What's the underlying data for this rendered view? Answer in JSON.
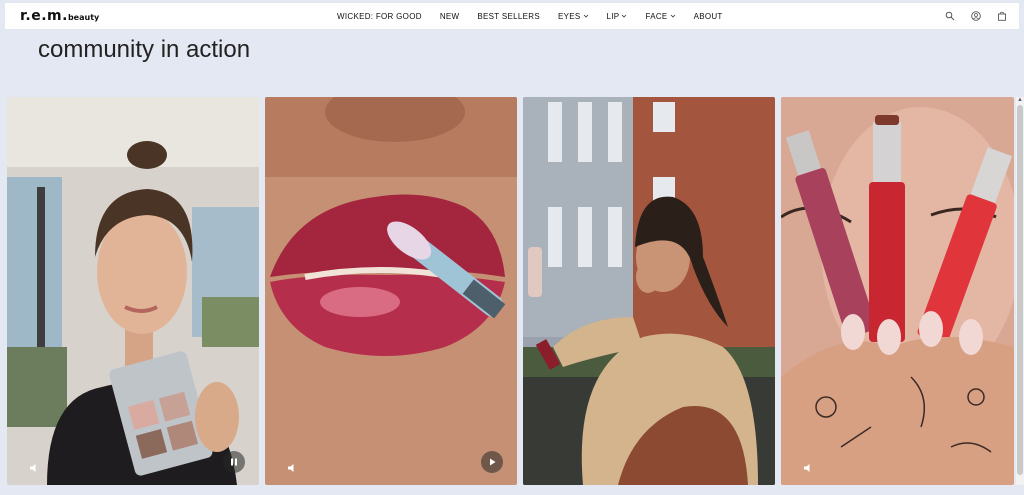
{
  "brand": {
    "logo_main": "r.e.m.",
    "logo_sub": "beauty"
  },
  "nav": {
    "items": [
      {
        "label": "WICKED: FOR GOOD",
        "dropdown": false
      },
      {
        "label": "NEW",
        "dropdown": false
      },
      {
        "label": "BEST SELLERS",
        "dropdown": false
      },
      {
        "label": "EYES",
        "dropdown": true
      },
      {
        "label": "LIP",
        "dropdown": true
      },
      {
        "label": "FACE",
        "dropdown": true
      },
      {
        "label": "ABOUT",
        "dropdown": false
      }
    ]
  },
  "tools": [
    "search-icon",
    "account-icon",
    "bag-icon"
  ],
  "section": {
    "title": "community in action"
  },
  "videos": [
    {
      "subject": "woman holding eyeshadow palette",
      "state": "playing"
    },
    {
      "subject": "close-up applying lip gloss",
      "state": "paused"
    },
    {
      "subject": "woman applying lipstick outdoors",
      "state": "none"
    },
    {
      "subject": "hands holding three lip glosses",
      "state": "none"
    }
  ],
  "colors": {
    "page_bg": "#e4e8f2",
    "header_bg": "#ffffff",
    "text": "#222222"
  }
}
